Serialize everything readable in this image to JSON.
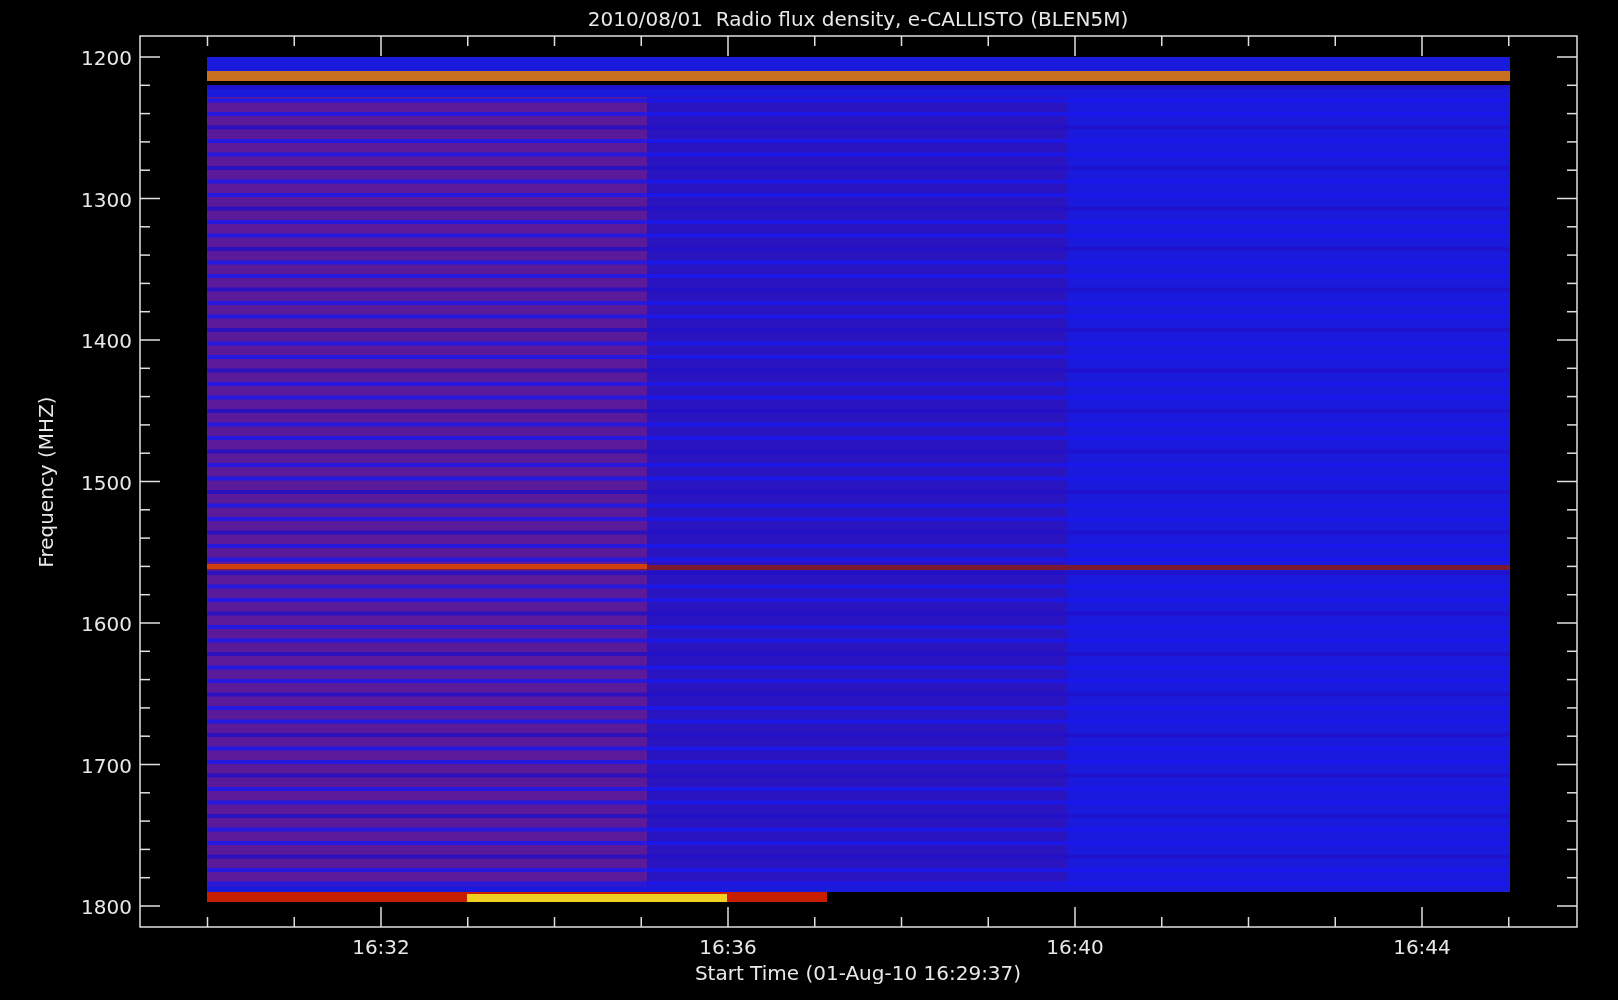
{
  "title": "2010/08/01  Radio flux density, e-CALLISTO (BLEN5M)",
  "y_axis": {
    "label": "Frequency (MHZ)",
    "ticks": [
      "1200",
      "1300",
      "1400",
      "1500",
      "1600",
      "1700",
      "1800"
    ]
  },
  "x_axis": {
    "label": "Start Time (01-Aug-10 16:29:37)",
    "ticks": [
      "16:32",
      "16:36",
      "16:40",
      "16:44"
    ]
  }
}
